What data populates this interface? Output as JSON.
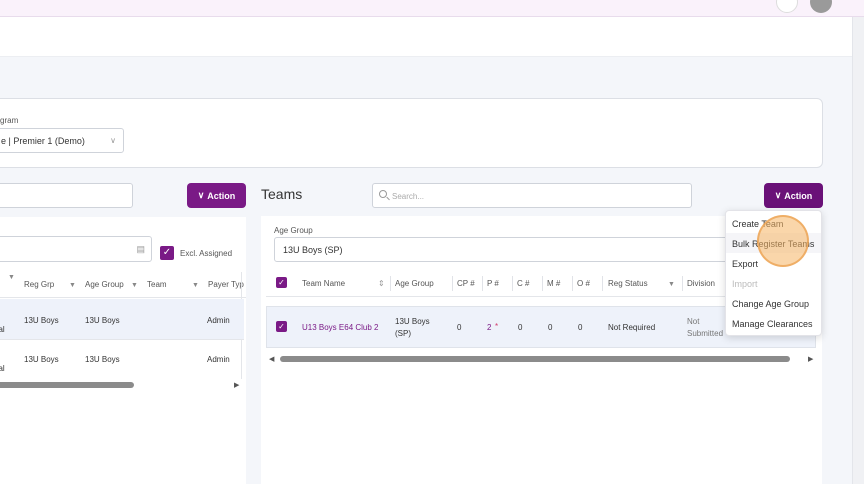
{
  "program": {
    "label": "gram",
    "value": "e | Premier 1 (Demo)"
  },
  "left": {
    "action_label": "Action",
    "excl_label": "Excl. Assigned",
    "columns": [
      "Reg Grp",
      "Age Group",
      "Team",
      "Payer Typ"
    ],
    "rows": [
      {
        "status": "oval",
        "reg_grp": "13U Boys",
        "age_group": "13U Boys",
        "payer": "Admin"
      },
      {
        "status": "oval",
        "reg_grp": "13U Boys",
        "age_group": "13U Boys",
        "payer": "Admin"
      }
    ]
  },
  "teams": {
    "title": "Teams",
    "search_placeholder": "Search...",
    "action_label": "Action",
    "age_group_label": "Age Group",
    "age_group_value": "13U Boys (SP)",
    "columns": {
      "team_name": "Team Name",
      "age_group": "Age Group",
      "cp": "CP #",
      "p": "P #",
      "c": "C #",
      "m": "M #",
      "o": "O #",
      "reg_status": "Reg Status",
      "division": "Division"
    },
    "row": {
      "team_name": "U13 Boys E64 Club 2",
      "age_group_line1": "13U Boys",
      "age_group_line2": "(SP)",
      "cp": "0",
      "p": "2",
      "p_mark": "*",
      "c": "0",
      "m": "0",
      "o": "0",
      "reg_status": "Not Required",
      "division_line1": "Not",
      "division_line2": "Submitted"
    }
  },
  "action_menu": {
    "items": [
      {
        "label": "Create Team",
        "enabled": true
      },
      {
        "label": "Bulk Register Teams",
        "enabled": true
      },
      {
        "label": "Export",
        "enabled": true
      },
      {
        "label": "Import",
        "enabled": false
      },
      {
        "label": "Change Age Group",
        "enabled": true
      },
      {
        "label": "Manage Clearances",
        "enabled": true
      }
    ]
  },
  "colors": {
    "accent": "#7a1a86",
    "cursor_highlight": "#f5b464"
  }
}
